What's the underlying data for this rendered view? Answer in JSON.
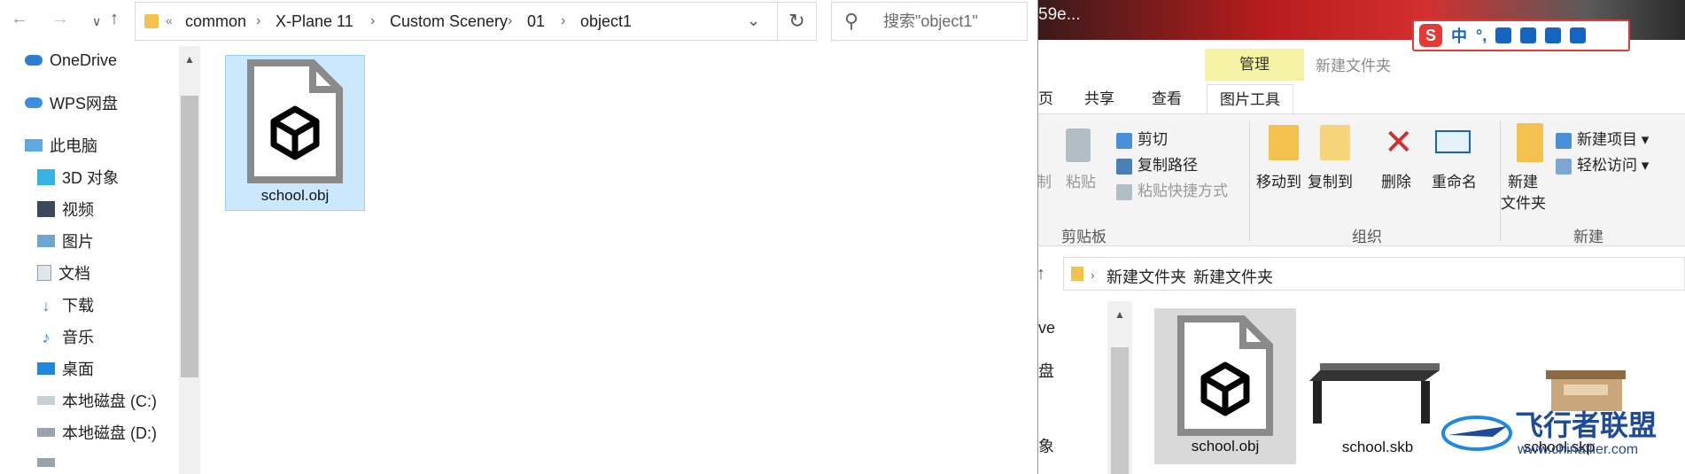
{
  "left_window": {
    "nav": {
      "back_icon": "arrow-left-icon",
      "forward_icon": "arrow-right-icon",
      "recent_icon": "chevron-down-icon",
      "up_icon": "arrow-up-icon"
    },
    "address": {
      "overflow": "«",
      "crumbs": [
        "common",
        "X-Plane 11",
        "Custom Scenery",
        "01",
        "object1"
      ]
    },
    "search": {
      "placeholder": "搜索\"object1\""
    },
    "sidebar": {
      "items": [
        {
          "label": "OneDrive",
          "icon": "cloud-icon"
        },
        {
          "label": "WPS网盘",
          "icon": "cloud-icon"
        },
        {
          "label": "此电脑",
          "icon": "computer-icon"
        },
        {
          "label": "3D 对象",
          "icon": "cube-3d-icon"
        },
        {
          "label": "视频",
          "icon": "video-icon"
        },
        {
          "label": "图片",
          "icon": "pictures-icon"
        },
        {
          "label": "文档",
          "icon": "document-icon"
        },
        {
          "label": "下载",
          "icon": "download-icon"
        },
        {
          "label": "音乐",
          "icon": "music-icon"
        },
        {
          "label": "桌面",
          "icon": "desktop-icon"
        },
        {
          "label": "本地磁盘 (C:)",
          "icon": "drive-c-icon"
        },
        {
          "label": "本地磁盘 (D:)",
          "icon": "drive-d-icon"
        }
      ]
    },
    "files": [
      {
        "name": "school.obj",
        "icon": "3d-object-file-icon",
        "selected": true
      }
    ]
  },
  "right_window": {
    "title_fragment": "59e...",
    "contextual_tab": "管理",
    "window_title": "新建文件夹",
    "tabs": {
      "partial": "页",
      "share": "共享",
      "view": "查看",
      "picture_tools": "图片工具"
    },
    "ribbon": {
      "paste": "粘贴",
      "partial_left": "制",
      "cut": "剪切",
      "copy_path": "复制路径",
      "paste_shortcut": "粘贴快捷方式",
      "clipboard_group": "剪贴板",
      "move_to": "移动到",
      "copy_to": "复制到",
      "delete": "删除",
      "rename": "重命名",
      "organize_group": "组织",
      "new_folder_line1": "新建",
      "new_folder_line2": "文件夹",
      "new_item": "新建项目",
      "easy_access": "轻松访问",
      "new_group": "新建"
    },
    "address": {
      "crumbs": [
        "新建文件夹",
        "新建文件夹"
      ]
    },
    "sidebar_fragments": [
      "ve",
      "盘",
      "象"
    ],
    "files": [
      {
        "name": "school.obj",
        "icon": "3d-object-file-icon"
      },
      {
        "name": "school.skb",
        "icon": "model-thumbnail-icon"
      },
      {
        "name": "school.skp",
        "icon": "model-thumbnail-icon"
      }
    ],
    "ime_bar": {
      "mode": "中",
      "punct": "°,"
    },
    "watermark": {
      "text": "飞行者联盟",
      "url": "www.chinaflier.com"
    }
  }
}
